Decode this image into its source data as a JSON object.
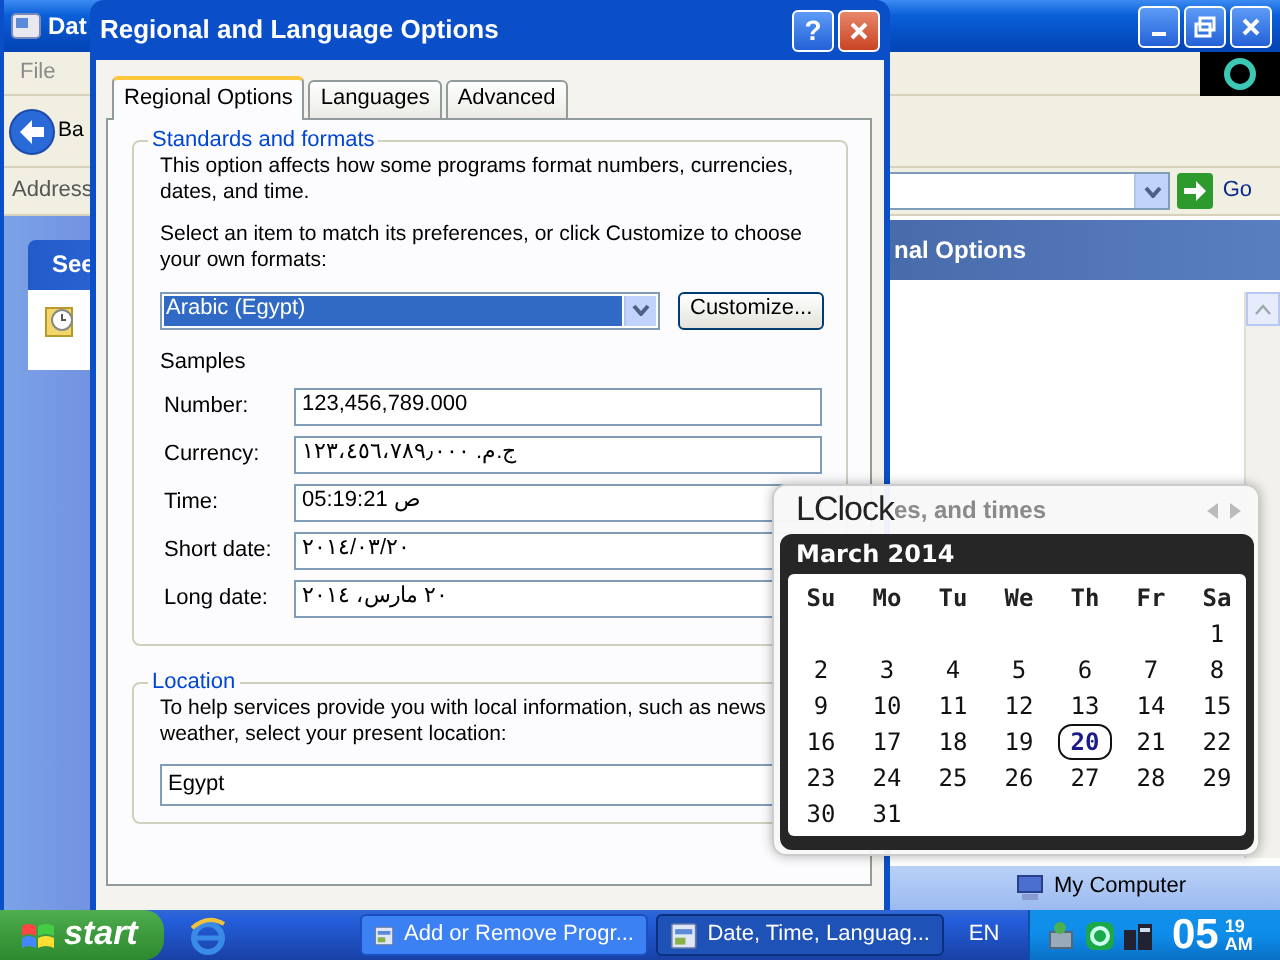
{
  "background_window": {
    "title": "Dat",
    "menu": [
      "File"
    ],
    "back_label": "Ba",
    "address_label": "Address",
    "go_label": "Go",
    "panel_title": "See",
    "header": "nal Options",
    "desktop_item": "My Computer"
  },
  "dialog": {
    "title": "Regional and Language Options",
    "help": "?",
    "tabs": [
      {
        "label": "Regional Options",
        "selected": true
      },
      {
        "label": "Languages",
        "selected": false
      },
      {
        "label": "Advanced",
        "selected": false
      }
    ],
    "standards": {
      "legend": "Standards and formats",
      "description": [
        "This option affects how some programs format numbers, currencies,",
        "dates, and time."
      ],
      "prompt": [
        "Select an item to match its preferences, or click Customize to choose",
        "your own formats:"
      ],
      "locale": "Arabic (Egypt)",
      "customize_button": "Customize...",
      "samples_title": "Samples",
      "samples": [
        {
          "label": "Number:",
          "value": "123,456,789.000"
        },
        {
          "label": "Currency:",
          "value": "ج.م. ١٢٣،٤٥٦،٧٨٩٫٠٠٠"
        },
        {
          "label": "Time:",
          "value": "05:19:21 ص"
        },
        {
          "label": "Short date:",
          "value": "٢٠١٤/٠٣/٢٠"
        },
        {
          "label": "Long date:",
          "value": "٢٠ مارس، ٢٠١٤"
        }
      ]
    },
    "location": {
      "legend": "Location",
      "description": [
        "To help services provide you with local information, such as news",
        "weather, select your present location:"
      ],
      "value": "Egypt"
    }
  },
  "clock_popup": {
    "title": "LClock",
    "underlying_text": "es, and times",
    "month": "March 2014",
    "weekdays": [
      "Su",
      "Mo",
      "Tu",
      "We",
      "Th",
      "Fr",
      "Sa"
    ],
    "weeks": [
      [
        {
          "day": "1",
          "selected": false
        }
      ],
      [
        {
          "day": "2",
          "selected": false
        },
        {
          "day": "3",
          "selected": false
        },
        {
          "day": "4",
          "selected": false
        },
        {
          "day": "5",
          "selected": false
        },
        {
          "day": "6",
          "selected": false
        },
        {
          "day": "7",
          "selected": false
        },
        {
          "day": "8",
          "selected": false
        }
      ],
      [
        {
          "day": "9",
          "selected": false
        },
        {
          "day": "10",
          "selected": false
        },
        {
          "day": "11",
          "selected": false
        },
        {
          "day": "12",
          "selected": false
        },
        {
          "day": "13",
          "selected": false
        },
        {
          "day": "14",
          "selected": false
        },
        {
          "day": "15",
          "selected": false
        }
      ],
      [
        {
          "day": "16",
          "selected": false
        },
        {
          "day": "17",
          "selected": false
        },
        {
          "day": "18",
          "selected": false
        },
        {
          "day": "19",
          "selected": false
        },
        {
          "day": "20",
          "selected": true
        },
        {
          "day": "21",
          "selected": false
        },
        {
          "day": "22",
          "selected": false
        }
      ],
      [
        {
          "day": "23",
          "selected": false
        },
        {
          "day": "24",
          "selected": false
        },
        {
          "day": "25",
          "selected": false
        },
        {
          "day": "26",
          "selected": false
        },
        {
          "day": "27",
          "selected": false
        },
        {
          "day": "28",
          "selected": false
        },
        {
          "day": "29",
          "selected": false
        }
      ],
      [
        {
          "day": "30",
          "selected": false
        },
        {
          "day": "31",
          "selected": false
        }
      ]
    ]
  },
  "taskbar": {
    "start": "start",
    "tasks": [
      {
        "label": "Add or Remove Progr...",
        "selected": false
      },
      {
        "label": "Date, Time, Languag...",
        "selected": true
      }
    ],
    "language": "EN",
    "clock_hour": "05",
    "clock_minute": "19",
    "clock_ampm": "AM"
  }
}
